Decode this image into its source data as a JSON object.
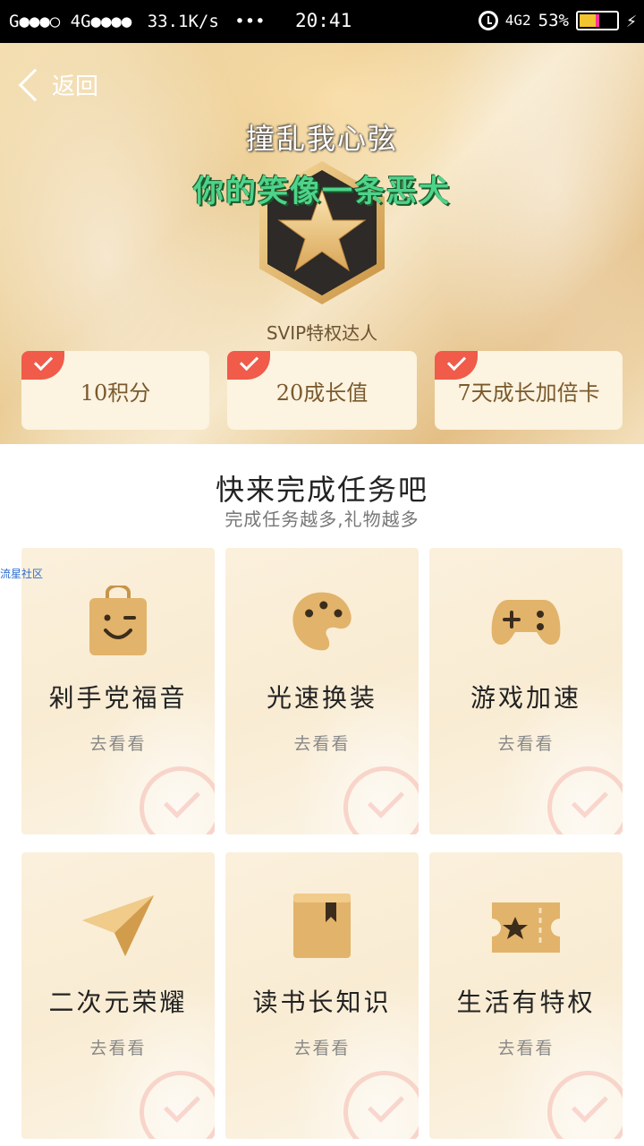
{
  "status_bar": {
    "carrier": "G●●●○ 4G●●●●",
    "speed": "33.1K/s",
    "dots": "•••",
    "time": "20:41",
    "network": "4G2",
    "battery": "53%",
    "battery_level": 0.53
  },
  "header": {
    "back_label": "返回",
    "signature_line1": "撞乱我心弦",
    "signature_line2": "你的笑像一条恶犬",
    "badge_label": "SVIP特权达人"
  },
  "rewards": [
    {
      "label": "10积分"
    },
    {
      "label": "20成长值"
    },
    {
      "label": "7天成长加倍卡"
    }
  ],
  "tasks_section": {
    "title": "快来完成任务吧",
    "subtitle": "完成任务越多,礼物越多",
    "watermark": "流星社区"
  },
  "tasks": [
    {
      "title": "剁手党福音",
      "action": "去看看",
      "icon": "shopping-bag-icon"
    },
    {
      "title": "光速换装",
      "action": "去看看",
      "icon": "palette-icon"
    },
    {
      "title": "游戏加速",
      "action": "去看看",
      "icon": "gamepad-icon"
    },
    {
      "title": "二次元荣耀",
      "action": "去看看",
      "icon": "paper-plane-icon"
    },
    {
      "title": "读书长知识",
      "action": "去看看",
      "icon": "book-icon"
    },
    {
      "title": "生活有特权",
      "action": "去看看",
      "icon": "ticket-icon"
    }
  ],
  "colors": {
    "accent_gold": "#e2b36a",
    "check_red": "#f05b4a",
    "signature_green": "#4ed38a"
  }
}
